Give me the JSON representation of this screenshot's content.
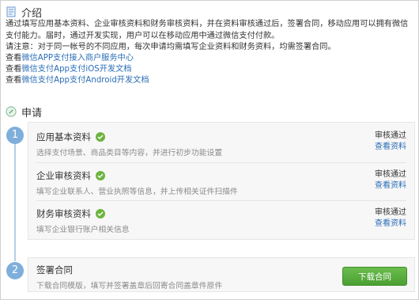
{
  "intro": {
    "title": "介绍",
    "paragraph": "通过填写应用基本资料、企业审核资料和财务审核资料，并在资料审核通过后，签署合同，移动应用可以拥有微信支付能力。届时，通过开发实现，用户可以在移动应用中通过微信支付付款。",
    "note": "请注意：对于同一帐号的不同应用，每次申请均需填写企业资料和财务资料，均需签署合同。",
    "links": [
      {
        "prefix": "查看",
        "text": "微信APP支付接入商户服务中心"
      },
      {
        "prefix": "查看",
        "text": "微信支付App支付iOS开发文档"
      },
      {
        "prefix": "查看",
        "text": "微信支付App支付Android开发文档"
      }
    ]
  },
  "apply": {
    "title": "申请",
    "steps": [
      {
        "number": "1",
        "items": [
          {
            "title": "应用基本资料",
            "desc": "选择支付场景、商品类目等内容，并进行初步功能设置",
            "status": "审核通过",
            "link": "查看资料"
          },
          {
            "title": "企业审核资料",
            "desc": "填写企业联系人、营业执照等信息，并上传相关证件扫描件",
            "status": "审核通过",
            "link": "查看资料"
          },
          {
            "title": "财务审核资料",
            "desc": "填写企业银行账户相关信息",
            "status": "审核通过",
            "link": "查看资料"
          }
        ]
      },
      {
        "number": "2",
        "title": "签署合同",
        "desc": "下载合同模版，填写并签署盖章后回寄合同盖章件原件",
        "button": "下载合同"
      }
    ]
  },
  "colors": {
    "accent_link": "#2a6db7",
    "step_badge": "#7faedb",
    "check": "#6db33f",
    "download_button": "#5aa93f"
  }
}
